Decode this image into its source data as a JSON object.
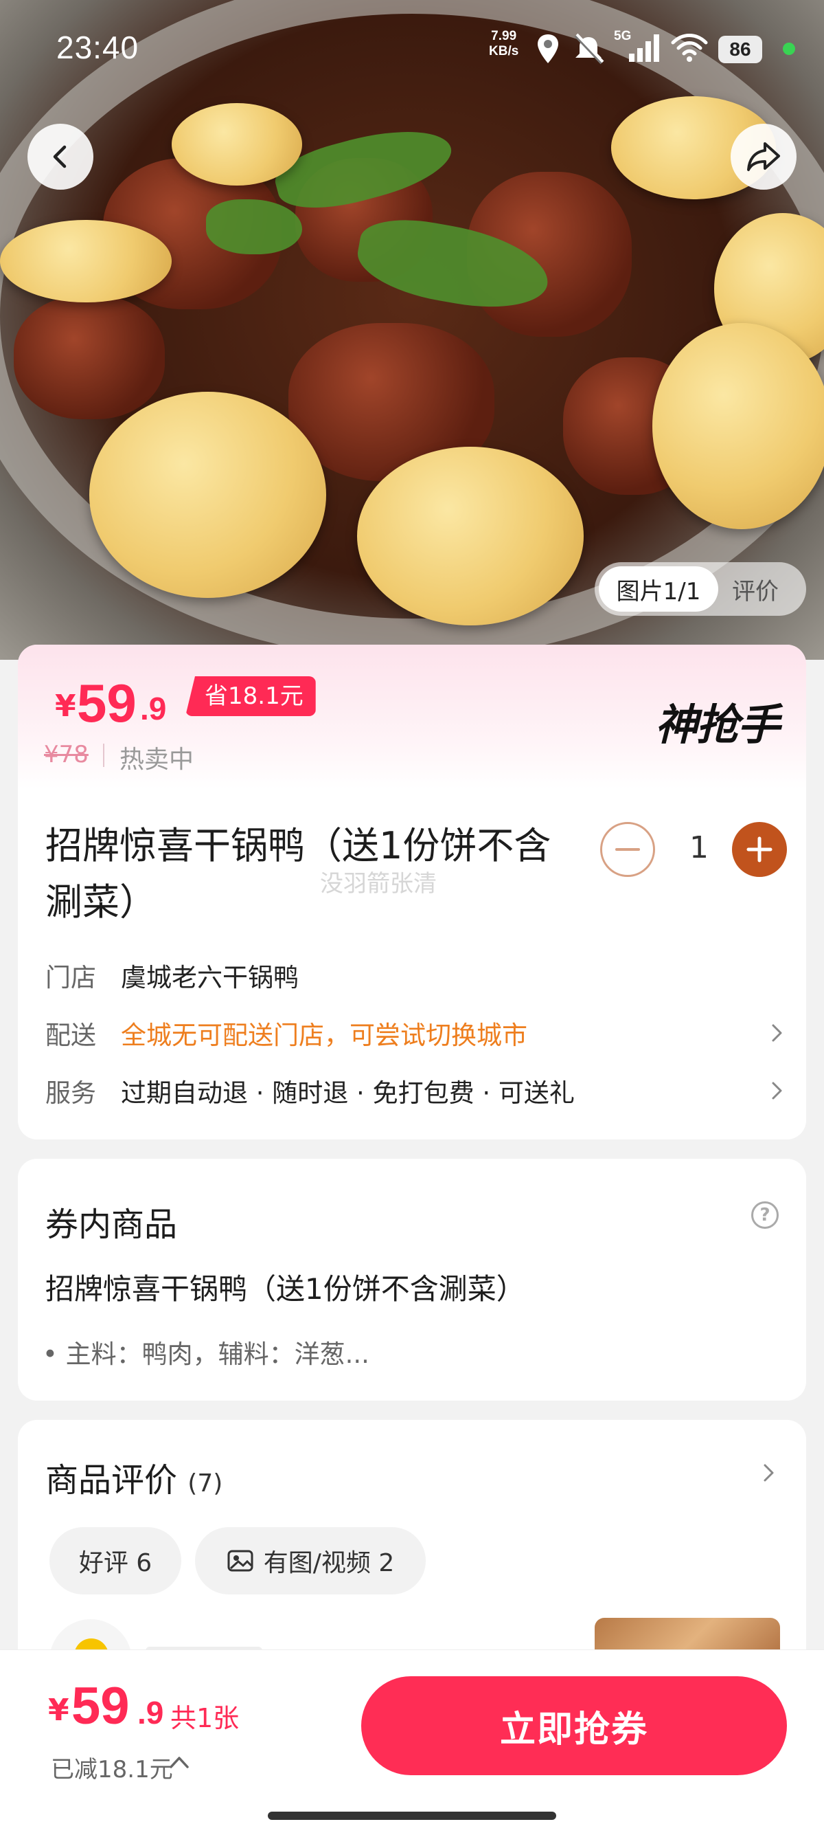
{
  "status_bar": {
    "time": "23:40",
    "net_speed_value": "7.99",
    "net_speed_unit": "KB/s",
    "signal_label": "5G",
    "battery": "86"
  },
  "gallery": {
    "active_tab": "图片1/1",
    "other_tab": "评价"
  },
  "price": {
    "currency": "¥",
    "integer": "59",
    "decimal": ".9",
    "save_badge": "省18.1元",
    "original": "¥78",
    "status": "热卖中",
    "brand_logo": "神抢手"
  },
  "product": {
    "title": "招牌惊喜干锅鸭（送1份饼不含涮菜）",
    "watermark": "没羽箭张清",
    "quantity": "1",
    "store_label": "门店",
    "store_value": "虞城老六干锅鸭",
    "delivery_label": "配送",
    "delivery_value": "全城无可配送门店，可尝试切换城市",
    "service_label": "服务",
    "service_value": "过期自动退 · 随时退 · 免打包费 · 可送礼"
  },
  "voucher_items": {
    "title": "券内商品",
    "item_name": "招牌惊喜干锅鸭（送1份饼不含涮菜）",
    "item_detail": "• 主料：鸭肉，辅料：洋葱..."
  },
  "reviews": {
    "title": "商品评价",
    "count": "(7)",
    "chip_good": "好评 6",
    "chip_media": "有图/视频 2"
  },
  "bottom_bar": {
    "currency": "¥",
    "integer": "59",
    "decimal": ".9",
    "count": "共1张",
    "reduced": "已减18.1元",
    "cta": "立即抢券"
  },
  "colors": {
    "accent": "#ff2a55",
    "orange_text": "#ee7e1e",
    "stepper_plus": "#c1531d"
  }
}
